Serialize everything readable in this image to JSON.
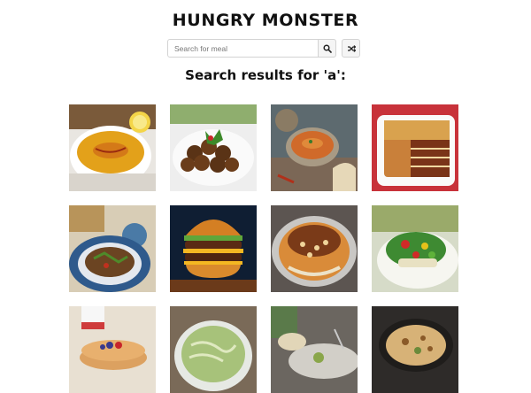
{
  "header": {
    "title": "HUNGRY MONSTER"
  },
  "search": {
    "placeholder": "Search for meal",
    "value": "",
    "search_icon": "search-icon",
    "random_icon": "shuffle-icon"
  },
  "results": {
    "heading": "Search results for 'a':",
    "meals": [
      {
        "name": "meal-lentil-soup",
        "image": "soup bowl with lemon"
      },
      {
        "name": "meal-falafel",
        "image": "falafel plate with herbs"
      },
      {
        "name": "meal-curry",
        "image": "curry bowl with bread"
      },
      {
        "name": "meal-lasagne",
        "image": "baked lasagne dish"
      },
      {
        "name": "meal-salad-plate",
        "image": "blue patterned plate of stew"
      },
      {
        "name": "meal-burger",
        "image": "double cheeseburger"
      },
      {
        "name": "meal-koshari",
        "image": "koshari rice and pasta"
      },
      {
        "name": "meal-green-salad",
        "image": "salad with peppers"
      },
      {
        "name": "meal-pancakes",
        "image": "pancakes with berries"
      },
      {
        "name": "meal-pasta-bowl",
        "image": "green pasta bowl"
      },
      {
        "name": "meal-platter",
        "image": "platter dish"
      },
      {
        "name": "meal-gratin",
        "image": "gratin in pan"
      }
    ]
  }
}
